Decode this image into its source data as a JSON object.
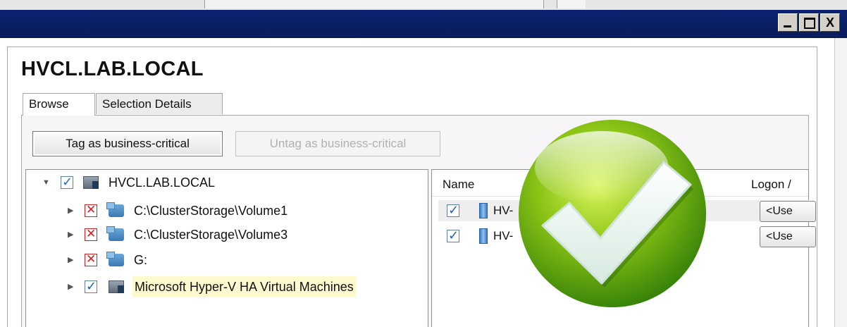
{
  "window": {
    "title": "",
    "controls": {
      "minimize": "_",
      "maximize": "□",
      "close": "X"
    }
  },
  "page": {
    "title": "HVCL.LAB.LOCAL"
  },
  "tabs": [
    {
      "label": "Browse",
      "active": true
    },
    {
      "label": "Selection Details",
      "active": false
    }
  ],
  "toolbar": {
    "tag_label": "Tag as business-critical",
    "untag_label": "Untag as business-critical"
  },
  "tree": {
    "root": {
      "label": "HVCL.LAB.LOCAL",
      "state": "partial",
      "icon": "cluster-icon",
      "expanded": true
    },
    "children": [
      {
        "label": "C:\\ClusterStorage\\Volume1",
        "state": "excluded",
        "icon": "storage-icon"
      },
      {
        "label": "C:\\ClusterStorage\\Volume3",
        "state": "excluded",
        "icon": "storage-icon"
      },
      {
        "label": "G:",
        "state": "excluded",
        "icon": "storage-icon"
      },
      {
        "label": "Microsoft Hyper-V HA Virtual Machines",
        "state": "checked",
        "icon": "hyperv-icon",
        "highlighted": true
      }
    ]
  },
  "list": {
    "columns": {
      "name": "Name",
      "logon": "Logon /"
    },
    "rows": [
      {
        "name": "HV-",
        "checked": true,
        "logon": "<Use"
      },
      {
        "name": "HV-",
        "checked": true,
        "logon": "<Use"
      }
    ]
  },
  "overlay": {
    "icon": "success-checkmark-icon",
    "colors": {
      "light": "#c8ec3a",
      "dark": "#2f7d08"
    }
  }
}
